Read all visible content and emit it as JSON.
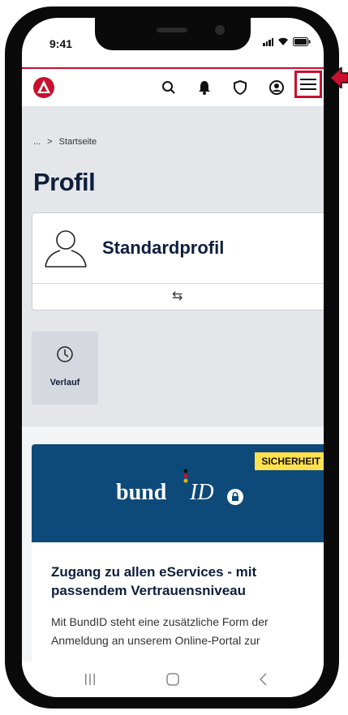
{
  "status_bar": {
    "time": "9:41"
  },
  "breadcrumb": {
    "ellipsis": "...",
    "separator": ">",
    "current": "Startseite"
  },
  "page": {
    "title": "Profil"
  },
  "profile": {
    "name": "Standardprofil",
    "switch_icon": "⇆"
  },
  "history": {
    "label": "Verlauf"
  },
  "promo": {
    "badge": "SICHERHEIT",
    "logo_text_bund": "bund",
    "logo_text_id": "ID",
    "heading": "Zugang zu allen eServices - mit passendem Vertrauensniveau",
    "body": "Mit BundID steht eine zusätzliche Form der Anmeldung an unserem Online-Portal zur"
  },
  "colors": {
    "brand_red": "#c8102e",
    "navy": "#0e1f3b",
    "banner": "#0d4a79",
    "badge_yellow": "#ffe14d"
  },
  "icons": [
    "search-icon",
    "bell-icon",
    "shield-icon",
    "user-icon",
    "menu-icon",
    "clock-icon",
    "user-outline-icon",
    "lock-icon"
  ]
}
